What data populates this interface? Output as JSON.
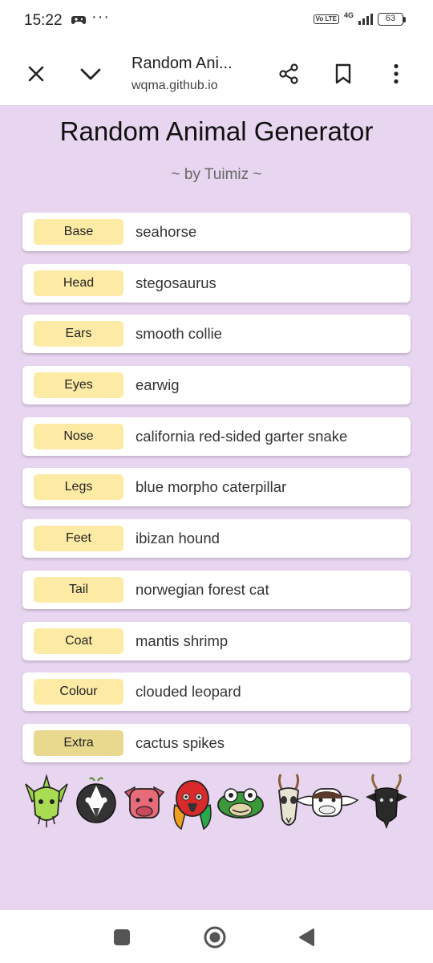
{
  "status_bar": {
    "time": "15:22",
    "more": "···",
    "volte": "Vo LTE",
    "network": "4G",
    "battery": "63"
  },
  "browser": {
    "tab_title": "Random Ani...",
    "url": "wqma.github.io",
    "icons": [
      "close-icon",
      "chevron-down-icon",
      "share-icon",
      "bookmark-icon",
      "more-vert-icon"
    ]
  },
  "page": {
    "title": "Random Animal Generator",
    "subtitle": "~ by Tuimiz ~",
    "rows": [
      {
        "label": "Base",
        "value": "seahorse"
      },
      {
        "label": "Head",
        "value": "stegosaurus"
      },
      {
        "label": "Ears",
        "value": "smooth collie"
      },
      {
        "label": "Eyes",
        "value": "earwig"
      },
      {
        "label": "Nose",
        "value": "california red-sided garter snake"
      },
      {
        "label": "Legs",
        "value": "blue morpho caterpillar"
      },
      {
        "label": "Feet",
        "value": "ibizan hound"
      },
      {
        "label": "Tail",
        "value": "norwegian forest cat"
      },
      {
        "label": "Coat",
        "value": "mantis shrimp"
      },
      {
        "label": "Colour",
        "value": "clouded leopard"
      },
      {
        "label": "Extra",
        "value": "cactus spikes"
      }
    ],
    "animal_icons": [
      "dragon-head-icon",
      "penguin-head-icon",
      "pig-head-icon",
      "parrot-head-icon",
      "frog-head-icon",
      "antelope-skull-icon",
      "cow-head-icon",
      "goat-head-icon"
    ]
  },
  "colors": {
    "page_background": "#e8d5f0",
    "chip": "#fdeba5",
    "chip_extra": "#e8d98e"
  },
  "nav_bar": {
    "icons": [
      "recents-icon",
      "home-icon",
      "back-icon"
    ]
  }
}
